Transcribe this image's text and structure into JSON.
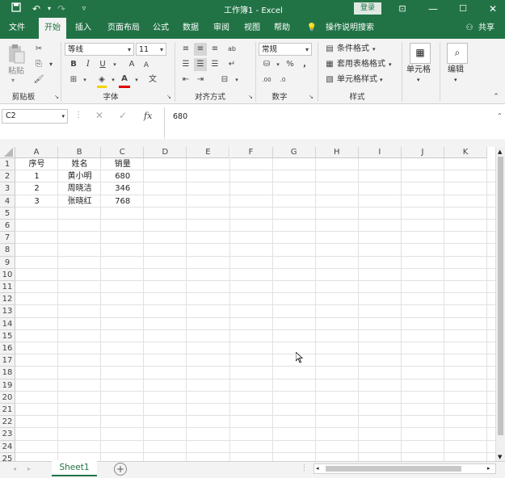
{
  "window": {
    "title": "工作簿1  -  Excel",
    "login_label": "登录"
  },
  "quick_access": {
    "save_icon": "save-icon",
    "undo_icon": "undo-icon",
    "redo_icon": "redo-icon",
    "customize_icon": "customize-icon"
  },
  "tabs": [
    {
      "label": "文件"
    },
    {
      "label": "开始"
    },
    {
      "label": "插入"
    },
    {
      "label": "页面布局"
    },
    {
      "label": "公式"
    },
    {
      "label": "数据"
    },
    {
      "label": "审阅"
    },
    {
      "label": "视图"
    },
    {
      "label": "帮助"
    },
    {
      "label": "操作说明搜索"
    }
  ],
  "share_label": "共享",
  "ribbon": {
    "clipboard": {
      "label": "剪贴板",
      "paste_label": "粘贴"
    },
    "font": {
      "label": "字体",
      "font_name": "等线",
      "font_size": "11",
      "bold": "B",
      "italic": "I",
      "underline": "U",
      "grow": "A",
      "shrink": "A",
      "font_color": "A"
    },
    "alignment": {
      "label": "对齐方式"
    },
    "number": {
      "label": "数字",
      "format": "常规",
      "percent": "%",
      "comma": ","
    },
    "styles": {
      "label": "样式",
      "conditional": "条件格式",
      "table": "套用表格格式",
      "cell_styles": "单元格样式"
    },
    "cells": {
      "label": "单元格"
    },
    "editing": {
      "label": "编辑"
    }
  },
  "formula_bar": {
    "name_box": "C2",
    "value": "680",
    "fx": "fx"
  },
  "columns": [
    "A",
    "B",
    "C",
    "D",
    "E",
    "F",
    "G",
    "H",
    "I",
    "J",
    "K"
  ],
  "rows": [
    "1",
    "2",
    "3",
    "4",
    "5",
    "6",
    "7",
    "8",
    "9",
    "10",
    "11",
    "12",
    "13",
    "14",
    "15",
    "16",
    "17",
    "18",
    "19",
    "20",
    "21",
    "22",
    "23",
    "24",
    "25"
  ],
  "table": {
    "headers": [
      "序号",
      "姓名",
      "销量"
    ],
    "data": [
      [
        "1",
        "黄小明",
        "680"
      ],
      [
        "2",
        "周晓洁",
        "346"
      ],
      [
        "3",
        "张晓红",
        "768"
      ]
    ]
  },
  "sheet": {
    "tab_label": "Sheet1",
    "add_icon": "add-sheet-icon"
  }
}
